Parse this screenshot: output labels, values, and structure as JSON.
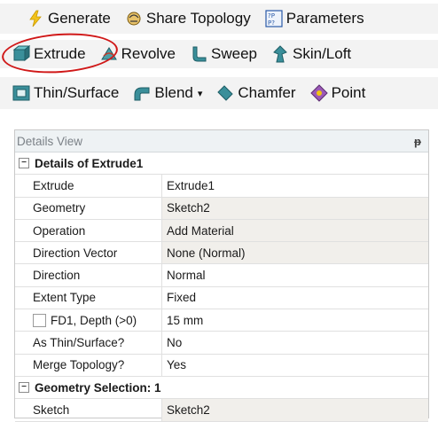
{
  "toolbar_row1": [
    {
      "label": "Generate",
      "icon": "lightning-icon"
    },
    {
      "label": "Share Topology",
      "icon": "share-topology-icon"
    },
    {
      "label": "Parameters",
      "icon": "parameters-icon"
    }
  ],
  "toolbar_row2": [
    {
      "label": "Extrude",
      "icon": "extrude-icon"
    },
    {
      "label": "Revolve",
      "icon": "revolve-icon"
    },
    {
      "label": "Sweep",
      "icon": "sweep-icon"
    },
    {
      "label": "Skin/Loft",
      "icon": "skin-loft-icon"
    }
  ],
  "toolbar_row3": [
    {
      "label": "Thin/Surface",
      "icon": "thin-surface-icon"
    },
    {
      "label": "Blend",
      "icon": "blend-icon",
      "dropdown": "▾"
    },
    {
      "label": "Chamfer",
      "icon": "chamfer-icon"
    },
    {
      "label": "Point",
      "icon": "point-icon"
    }
  ],
  "details": {
    "panel_title": "Details View",
    "pin_glyph": "ᵽ",
    "group1": {
      "title": "Details of Extrude1",
      "toggle": "−"
    },
    "rows": [
      {
        "name": "Extrude",
        "value": "Extrude1",
        "shaded": false
      },
      {
        "name": "Geometry",
        "value": "Sketch2",
        "shaded": true
      },
      {
        "name": "Operation",
        "value": "Add Material",
        "shaded": true
      },
      {
        "name": "Direction Vector",
        "value": "None (Normal)",
        "shaded": true
      },
      {
        "name": "Direction",
        "value": "Normal",
        "shaded": false
      },
      {
        "name": "Extent Type",
        "value": "Fixed",
        "shaded": false
      },
      {
        "name": "FD1, Depth (>0)",
        "value": "15 mm",
        "shaded": false,
        "checkbox": true
      },
      {
        "name": "As Thin/Surface?",
        "value": "No",
        "shaded": false
      },
      {
        "name": "Merge Topology?",
        "value": "Yes",
        "shaded": false
      }
    ],
    "group2": {
      "title": "Geometry Selection: 1",
      "toggle": "−"
    },
    "rows2": [
      {
        "name": "Sketch",
        "value": "Sketch2",
        "shaded": true
      }
    ]
  },
  "colors": {
    "highlight_circle": "#d01818",
    "shaded_cell": "#f1efeb",
    "toolbar_bg": "#f3f3f3"
  }
}
